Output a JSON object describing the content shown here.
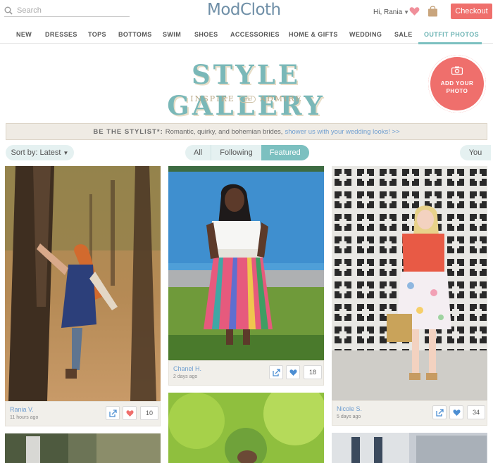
{
  "header": {
    "search_placeholder": "Search",
    "logo": "ModCloth",
    "greeting": "Hi, Rania",
    "checkout_label": "Checkout"
  },
  "nav": {
    "items": [
      "NEW",
      "DRESSES",
      "TOPS",
      "BOTTOMS",
      "SWIM",
      "SHOES",
      "ACCESSORIES",
      "HOME & GIFTS",
      "WEDDING",
      "SALE",
      "OUTFIT PHOTOS"
    ],
    "active": "OUTFIT PHOTOS"
  },
  "hero": {
    "title": "STYLE GALLERY",
    "tagline_left": "INSPIRE",
    "tagline_and": "and",
    "tagline_right": "ADMIRE",
    "add_photo_label_1": "ADD YOUR",
    "add_photo_label_2": "PHOTO"
  },
  "banner": {
    "lead": "BE THE STYLIST*:",
    "text": "Romantic, quirky, and bohemian brides,",
    "link": "shower us with your wedding looks! >>"
  },
  "filters": {
    "sort_label": "Sort by:",
    "sort_value": "Latest",
    "segments": [
      "All",
      "Following",
      "Featured"
    ],
    "active_segment": "Featured",
    "you_label": "You"
  },
  "cards": [
    {
      "user": "Rania V.",
      "time": "11 hours ago",
      "likes": "10",
      "liked": true
    },
    {
      "user": "Chanel H.",
      "time": "2 days ago",
      "likes": "18",
      "liked": false
    },
    {
      "user": "Nicole S.",
      "time": "5 days ago",
      "likes": "34",
      "liked": false
    }
  ],
  "colors": {
    "accent_teal": "#7cc0c0",
    "brand_coral": "#ef6f6c",
    "link_blue": "#6f9ed0",
    "logo_blue": "#6f8fa7"
  },
  "icons": [
    "search-icon",
    "heart-icon",
    "shopping-bag-icon",
    "camera-icon",
    "share-icon",
    "like-heart-icon"
  ]
}
